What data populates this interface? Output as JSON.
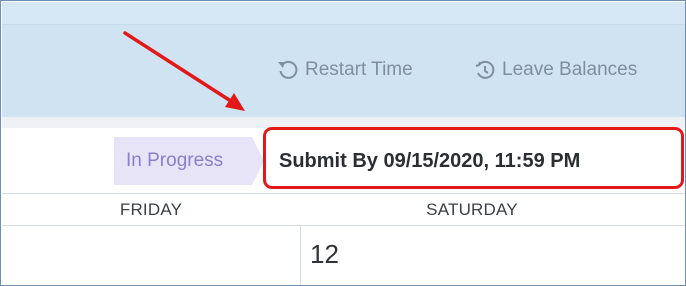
{
  "toolbar": {
    "restart_label": "Restart Time",
    "restart_icon": "restart-icon",
    "leave_label": "Leave Balances",
    "leave_icon": "clock-history-icon"
  },
  "status": {
    "badge": "In Progress",
    "submit_by": "Submit By 09/15/2020, 11:59 PM"
  },
  "calendar": {
    "days": [
      "FRIDAY",
      "SATURDAY"
    ],
    "dates": [
      "12"
    ]
  },
  "annotation": {
    "color": "#e31919"
  },
  "colors": {
    "toolbar_bg": "#cfe3f3",
    "badge_bg": "#e7e4f7",
    "badge_text": "#8a80c9",
    "tool_text": "#7f8f9f"
  }
}
